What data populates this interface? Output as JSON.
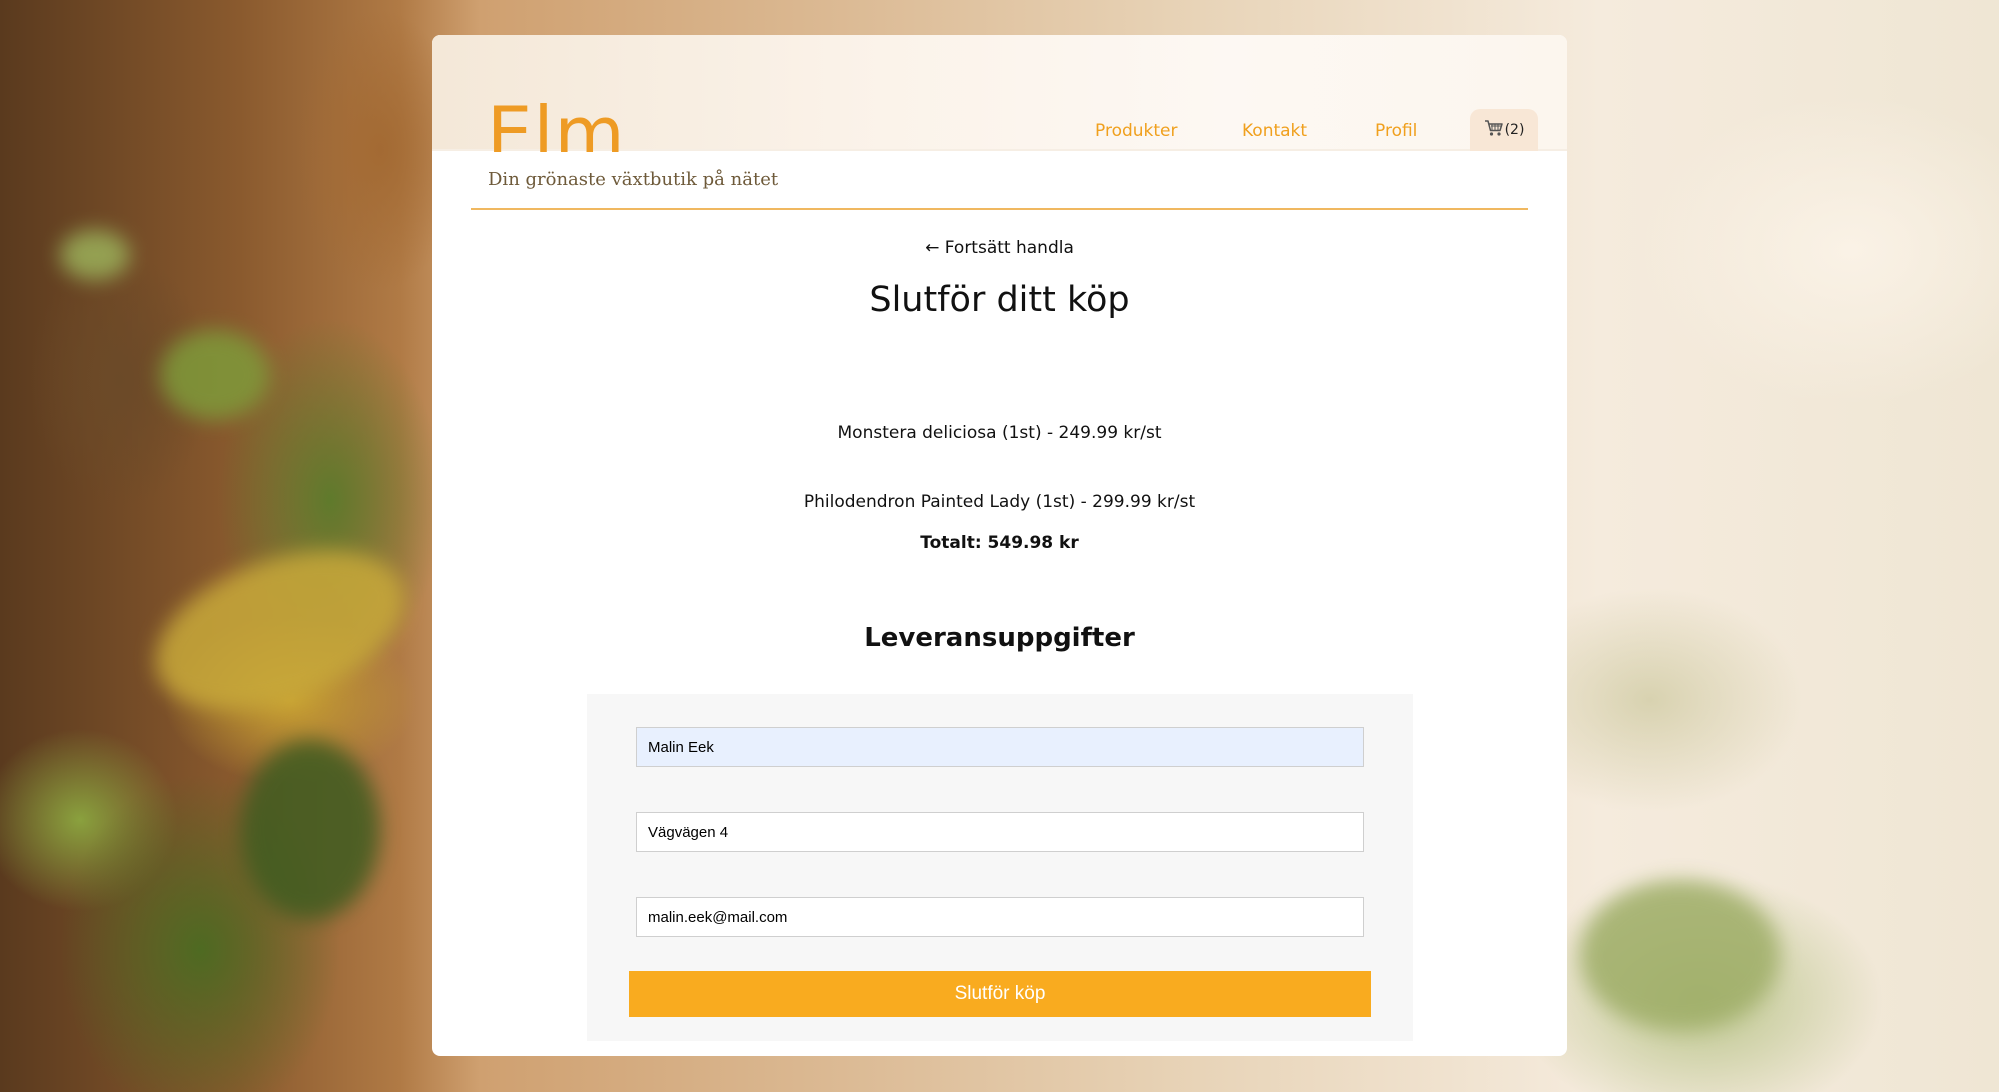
{
  "header": {
    "logo": "Elm",
    "tagline": "Din grönaste växtbutik på nätet",
    "nav": [
      "Produkter",
      "Kontakt",
      "Profil"
    ],
    "cart_count": "(2)"
  },
  "checkout": {
    "back_link": "← Fortsätt handla",
    "title": "Slutför ditt köp",
    "items": [
      "Monstera deliciosa (1st) - 249.99 kr/st",
      "Philodendron Painted Lady (1st) - 299.99 kr/st"
    ],
    "total": "Totalt: 549.98 kr"
  },
  "delivery": {
    "title": "Leveransuppgifter",
    "name_value": "Malin Eek",
    "address_value": "Vägvägen 4",
    "email_value": "malin.eek@mail.com",
    "submit_label": "Slutför köp"
  },
  "colors": {
    "accent": "#f9ab1f",
    "logo": "#ee9b24",
    "nav": "#f0a01e",
    "autofill": "#e8f0fe"
  },
  "icons": {
    "cart": "shopping-cart-icon"
  }
}
